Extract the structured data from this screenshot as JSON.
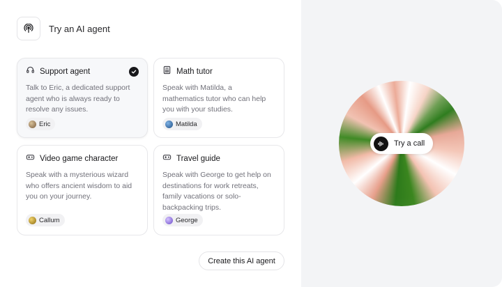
{
  "header": {
    "title": "Try an AI agent",
    "icon": "broadcast-icon"
  },
  "agents": [
    {
      "title": "Support agent",
      "icon": "headset-icon",
      "selected": true,
      "description": "Talk to Eric, a dedicated support agent who is always ready to resolve any issues.",
      "voice": "Eric",
      "avatar_color": "#a0826d"
    },
    {
      "title": "Math tutor",
      "icon": "calculator-icon",
      "selected": false,
      "description": "Speak with Matilda, a mathematics tutor who can help you with your studies.",
      "voice": "Matilda",
      "avatar_color": "#3b6ea5"
    },
    {
      "title": "Video game character",
      "icon": "gamepad-icon",
      "selected": false,
      "description": "Speak with a mysterious wizard who offers ancient wisdom to aid you on your journey.",
      "voice": "Callum",
      "avatar_color": "#c9a227"
    },
    {
      "title": "Travel guide",
      "icon": "gamepad-icon",
      "selected": false,
      "description": "Speak with George to get help on destinations for work retreats, family vacations or solo-backpacking trips.",
      "voice": "George",
      "avatar_color": "#9b7be0"
    }
  ],
  "create_button": "Create this AI agent",
  "call": {
    "label": "Try a call",
    "icon": "waveform-icon"
  },
  "colors": {
    "panel_bg": "#f3f4f6",
    "accent_dark": "#18181b",
    "orb_green": "#2f7d1f",
    "orb_peach": "#f1baa7"
  }
}
